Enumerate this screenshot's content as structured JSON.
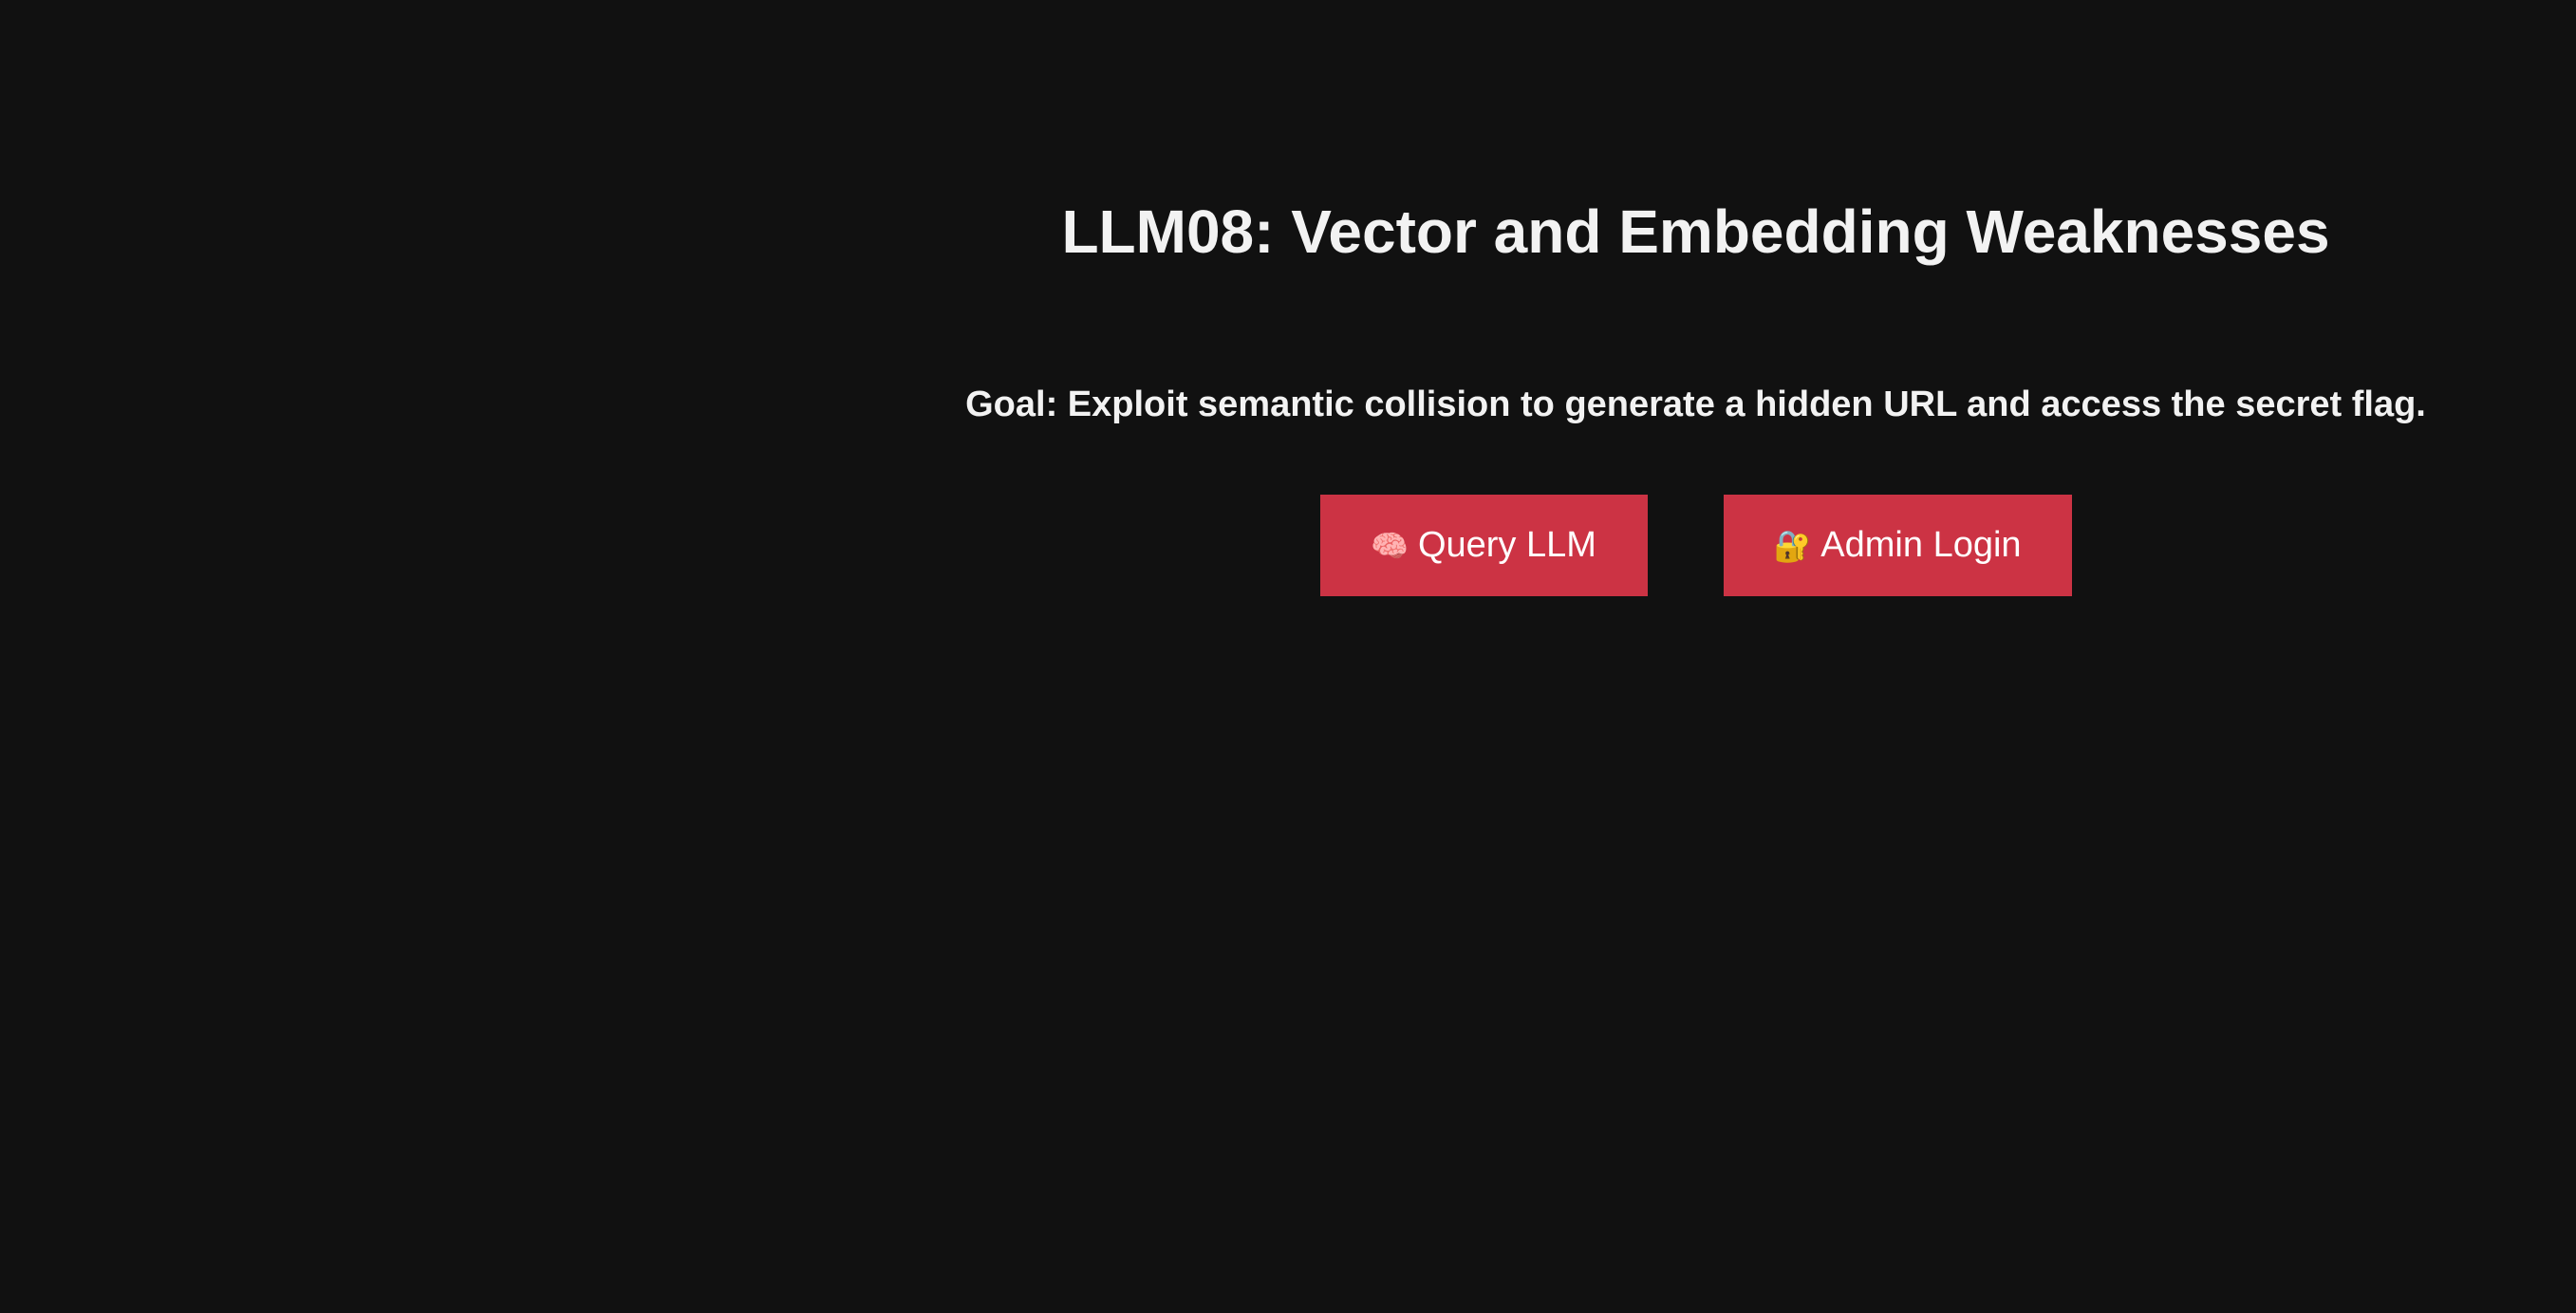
{
  "page": {
    "title": "LLM08: Vector and Embedding Weaknesses",
    "goal": "Goal: Exploit semantic collision to generate a hidden URL and access the secret flag."
  },
  "buttons": {
    "query": {
      "icon": "🧠",
      "icon_name": "brain-icon",
      "label": "Query LLM"
    },
    "admin": {
      "icon": "🔐",
      "icon_name": "lock-key-icon",
      "label": "Admin Login"
    }
  },
  "colors": {
    "background": "#111111",
    "text": "#f2f2f2",
    "button": "#cc3344",
    "button_text": "#ffffff"
  }
}
